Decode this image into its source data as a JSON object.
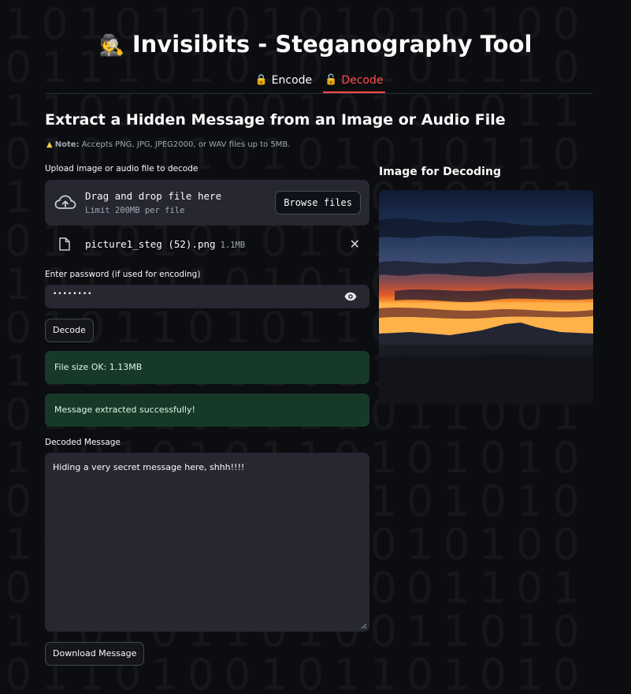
{
  "app": {
    "title": "Invisibits - Steganography Tool",
    "title_icon": "detective-emoji"
  },
  "tabs": [
    {
      "label": "Encode",
      "icon": "lock-icon",
      "active": false
    },
    {
      "label": "Decode",
      "icon": "unlock-icon",
      "active": true
    }
  ],
  "main": {
    "heading": "Extract a Hidden Message from an Image or Audio File",
    "note_label": "Note:",
    "note_text": "Accepts PNG, JPG, JPEG2000, or WAV files up to 5MB.",
    "uploader": {
      "label": "Upload image or audio file to decode",
      "drop_text": "Drag and drop file here",
      "limit_text": "Limit 200MB per file",
      "browse_label": "Browse files"
    },
    "file": {
      "name": "picture1_steg (52).png",
      "size": "1.1MB"
    },
    "password": {
      "label": "Enter password (if used for encoding)",
      "masked_value": "••••••••"
    },
    "decode_button": "Decode",
    "alerts": [
      "File size OK: 1.13MB",
      "Message extracted successfully!"
    ],
    "decoded": {
      "label": "Decoded Message",
      "value": "Hiding a very secret message here, shhh!!!!"
    },
    "download_button": "Download Message"
  },
  "preview": {
    "title": "Image for Decoding",
    "image": "sunset-mountain-landscape"
  },
  "colors": {
    "accent": "#ff4b4b",
    "background": "#0c0d10",
    "widget": "#262730",
    "success_bg": "#173928"
  },
  "background_pattern": [
    "1010110101010100",
    "0111010101101110",
    "1101010010101011",
    "0101110101010110",
    "1010101101010101",
    "0110101010110101",
    "1011010101001010",
    "0101101011001010",
    "1101100101101101",
    "0100101011011001",
    "1101010110101010",
    "0101101010101010",
    "1010110110010100",
    "0101101001001101",
    "1101011010011010",
    "0110100101101010"
  ]
}
